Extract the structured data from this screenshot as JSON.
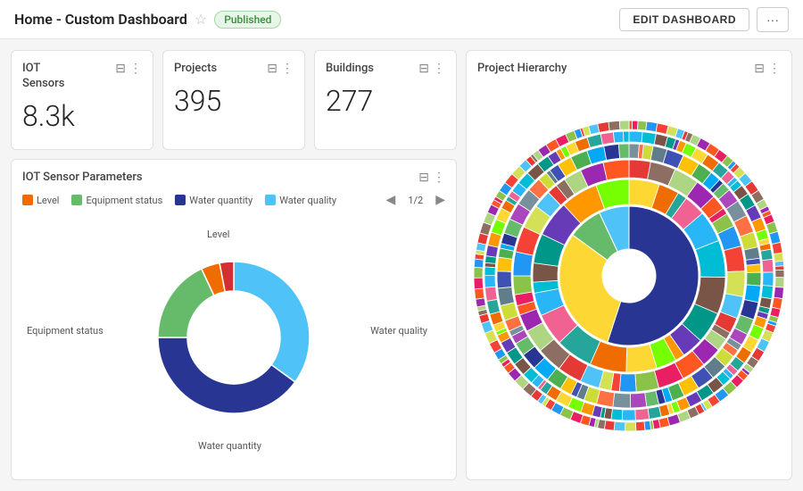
{
  "header": {
    "title": "Home - Custom Dashboard",
    "star_label": "☆",
    "badge": "Published",
    "edit_btn": "EDIT DASHBOARD",
    "more_btn": "···"
  },
  "cards": {
    "iot_sensors": {
      "title": "IOT\nSensors",
      "value": "8.3k"
    },
    "projects": {
      "title": "Projects",
      "value": "395"
    },
    "buildings": {
      "title": "Buildings",
      "value": "277"
    },
    "project_hierarchy": {
      "title": "Project Hierarchy"
    },
    "iot_params": {
      "title": "IOT Sensor Parameters",
      "legend": [
        {
          "label": "Water quality",
          "color": "#4fc3f7"
        },
        {
          "label": "Water quantity",
          "color": "#283593"
        },
        {
          "label": "Equipment status",
          "color": "#66bb6a"
        },
        {
          "label": "Level",
          "color": "#ef6c00"
        }
      ],
      "page": "1/2",
      "donut_labels": {
        "top": "Level",
        "right": "Water quality",
        "bottom": "Water quantity",
        "left": "Equipment status"
      }
    }
  },
  "icons": {
    "filter": "⊟",
    "dots": "⋮",
    "nav_prev": "◀",
    "nav_next": "▶"
  }
}
